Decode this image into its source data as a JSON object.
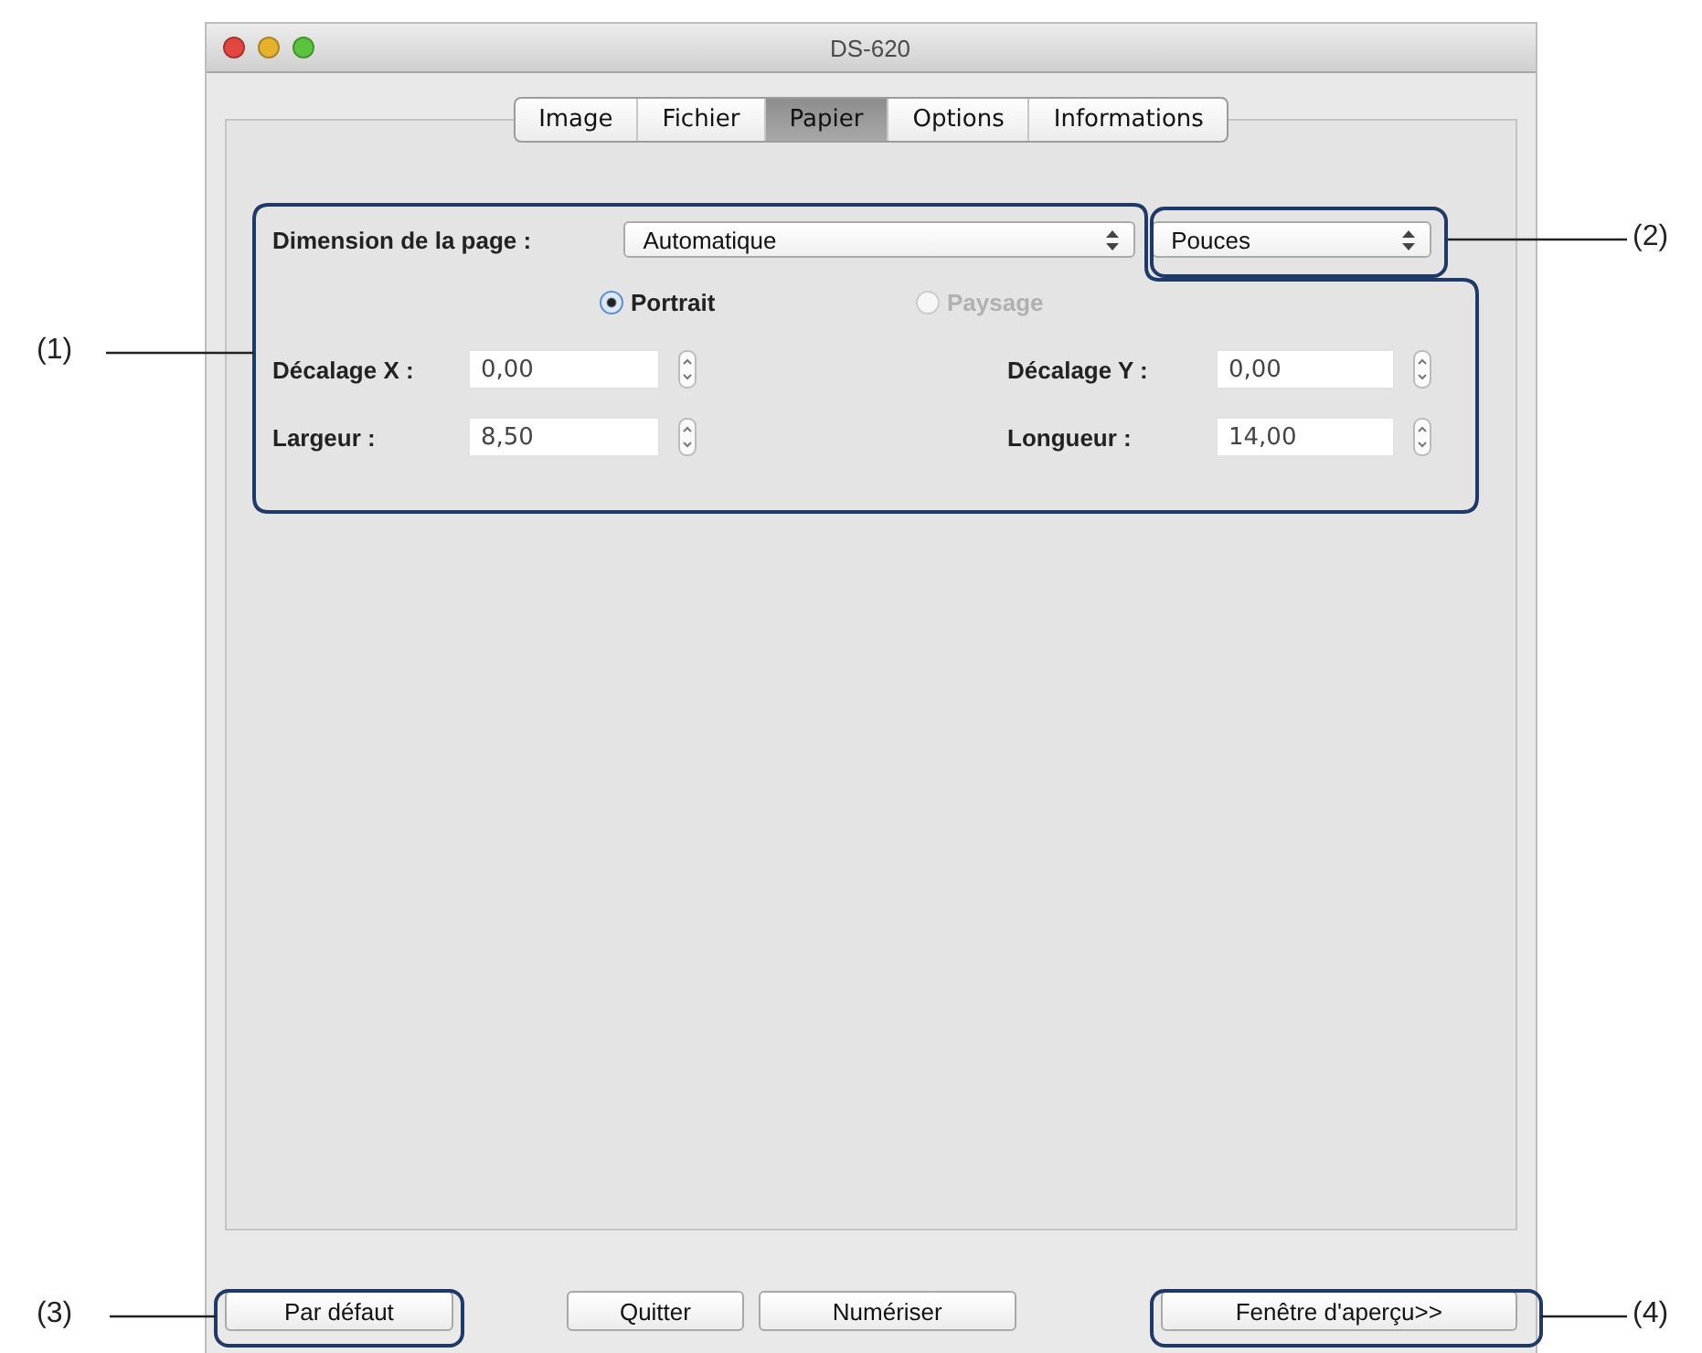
{
  "window": {
    "title": "DS-620"
  },
  "tabs": [
    {
      "label": "Image",
      "selected": false
    },
    {
      "label": "Fichier",
      "selected": false
    },
    {
      "label": "Papier",
      "selected": true
    },
    {
      "label": "Options",
      "selected": false
    },
    {
      "label": "Informations",
      "selected": false
    }
  ],
  "page_size": {
    "label": "Dimension de la page :",
    "value": "Automatique"
  },
  "units": {
    "value": "Pouces"
  },
  "orientation": [
    {
      "label": "Portrait",
      "selected": true,
      "disabled": false
    },
    {
      "label": "Paysage",
      "selected": false,
      "disabled": true
    }
  ],
  "fields": [
    {
      "label": "Décalage X :",
      "value": "0,00"
    },
    {
      "label": "Décalage Y :",
      "value": "0,00"
    },
    {
      "label": "Largeur :",
      "value": "8,50"
    },
    {
      "label": "Longueur :",
      "value": "14,00"
    }
  ],
  "buttons": [
    "Par défaut",
    "Quitter",
    "Numériser",
    "Fenêtre d'aperçu>>"
  ],
  "callouts": [
    "(2)",
    "(1)",
    "(3)",
    "(4)"
  ]
}
